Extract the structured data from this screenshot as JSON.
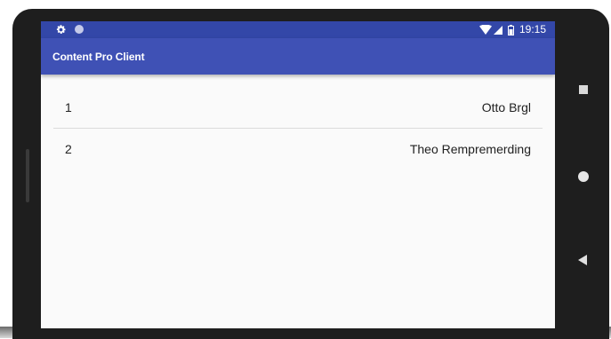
{
  "status_bar": {
    "time": "19:15",
    "icons": [
      "gear-icon",
      "circle-notification-icon",
      "wifi-icon",
      "cell-signal-icon",
      "battery-icon"
    ]
  },
  "app_bar": {
    "title": "Content Pro Client",
    "color": "#3f51b5",
    "status_color": "#3347a8"
  },
  "list": {
    "rows": [
      {
        "number": "1",
        "name": "Otto Brgl"
      },
      {
        "number": "2",
        "name": "Theo Rempremerding"
      }
    ]
  },
  "nav_bar": {
    "buttons": [
      "recents-square-icon",
      "home-circle-icon",
      "back-triangle-icon"
    ]
  }
}
